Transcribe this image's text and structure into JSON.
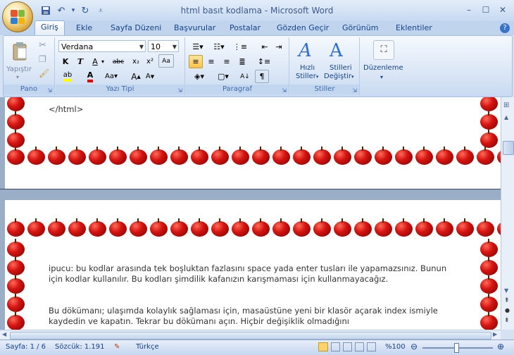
{
  "window": {
    "title": "html basıt kodlama - Microsoft Word",
    "controls": [
      "–",
      "☐",
      "✕"
    ]
  },
  "qat": {
    "icons": [
      "save-icon",
      "undo-icon",
      "redo-icon",
      "customize-icon"
    ]
  },
  "tabs": [
    {
      "label": "Giriş",
      "active": true
    },
    {
      "label": "Ekle"
    },
    {
      "label": "Sayfa Düzeni"
    },
    {
      "label": "Başvurular"
    },
    {
      "label": "Postalar"
    },
    {
      "label": "Gözden Geçir"
    },
    {
      "label": "Görünüm"
    },
    {
      "label": "Eklentiler"
    }
  ],
  "ribbon": {
    "pano": {
      "label": "Pano",
      "paste": "Yapıştır"
    },
    "font": {
      "label": "Yazı Tipi",
      "font_name": "Verdana",
      "font_size": "10"
    },
    "paragraph": {
      "label": "Paragraf"
    },
    "styles": {
      "label": "Stiller",
      "quick": "Hızlı",
      "quick2": "Stiller",
      "change": "Stilleri",
      "change2": "Değiştir"
    },
    "editing": {
      "label": "Düzenleme"
    }
  },
  "document": {
    "line_html": "</html>",
    "p1": "ipucu: bu kodlar arasında tek boşluktan fazlasını space yada enter tusları ile yapamazsınız. Bunun için kodlar kullanılır. Bu kodları şimdilik kafanızın karışmaması için kullanmayacağız.",
    "p2": "Bu dökümanı; ulaşımda kolaylık sağlaması için, masaüstüne yeni bir klasör açarak index ismiyle kaydedin ve kapatın. Tekrar bu dökümanı açın. Hiçbir değişiklik olmadığını"
  },
  "status": {
    "page": "Sayfa: 1 / 6",
    "words": "Sözcük: 1.191",
    "language": "Türkçe",
    "zoom": "%100"
  }
}
